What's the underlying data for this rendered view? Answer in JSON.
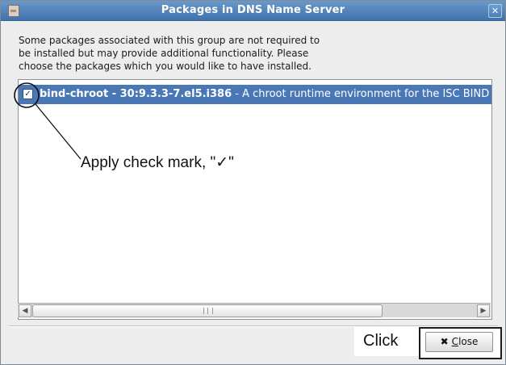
{
  "window": {
    "title": "Packages in DNS Name Server",
    "close_glyph": "✕"
  },
  "description": [
    "Some packages associated with this group are not required to",
    "be installed but may provide additional functionality.  Please",
    "choose the packages which you would like to have installed."
  ],
  "packages": [
    {
      "checked": true,
      "check_glyph": "✓",
      "name": "bind-chroot - 30:9.3.3-7.el5.i386",
      "summary": " - A chroot runtime environment for the ISC BIND"
    }
  ],
  "scrollbar": {
    "left_arrow": "◀",
    "right_arrow": "▶"
  },
  "buttons": {
    "close_mark": "✖",
    "close_mnemonic": "C",
    "close_rest": "lose"
  },
  "annotations": {
    "checkbox_callout": "Apply check mark, \"✓\"",
    "click_label": "Click"
  },
  "colors": {
    "titlebar": "#4f84bd",
    "selection": "#4a78b6",
    "dialog_bg": "#ededed"
  }
}
